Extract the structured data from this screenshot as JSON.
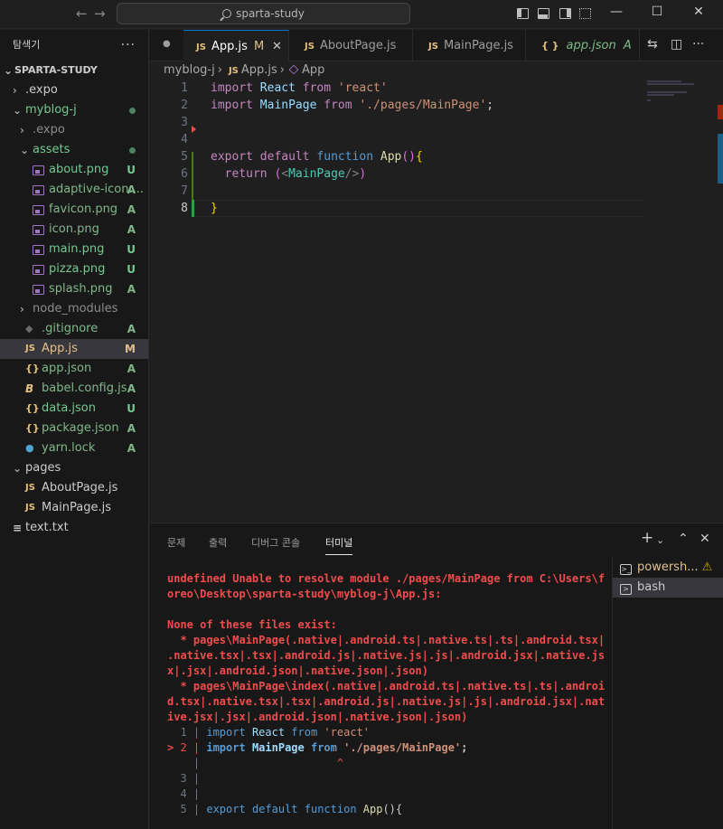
{
  "titlebar": {
    "search_text": "sparta-study",
    "back_icon": "arrow-left-icon",
    "forward_icon": "arrow-right-icon",
    "window_controls": [
      "minimize-icon",
      "maximize-icon",
      "close-icon"
    ]
  },
  "explorer": {
    "title": "탐색기",
    "more": "···",
    "root": "SPARTA-STUDY",
    "items": [
      {
        "label": ".expo",
        "type": "folder",
        "state": "collapsed",
        "status": ""
      },
      {
        "label": "myblog-j",
        "type": "folder",
        "state": "expanded",
        "status": "dot"
      },
      {
        "label": ".expo",
        "type": "folder",
        "state": "collapsed",
        "status": ""
      },
      {
        "label": "assets",
        "type": "folder",
        "state": "expanded",
        "status": "dot"
      },
      {
        "label": "about.png",
        "type": "image",
        "status": "U"
      },
      {
        "label": "adaptive-icon....",
        "type": "image",
        "status": "A"
      },
      {
        "label": "favicon.png",
        "type": "image",
        "status": "A"
      },
      {
        "label": "icon.png",
        "type": "image",
        "status": "A"
      },
      {
        "label": "main.png",
        "type": "image",
        "status": "U"
      },
      {
        "label": "pizza.png",
        "type": "image",
        "status": "U"
      },
      {
        "label": "splash.png",
        "type": "image",
        "status": "A"
      },
      {
        "label": "node_modules",
        "type": "folder",
        "state": "collapsed",
        "status": ""
      },
      {
        "label": ".gitignore",
        "type": "git",
        "status": "A"
      },
      {
        "label": "App.js",
        "type": "js",
        "status": "M"
      },
      {
        "label": "app.json",
        "type": "json",
        "status": "A"
      },
      {
        "label": "babel.config.js",
        "type": "babel",
        "status": "A"
      },
      {
        "label": "data.json",
        "type": "json",
        "status": "U"
      },
      {
        "label": "package.json",
        "type": "json",
        "status": "A"
      },
      {
        "label": "yarn.lock",
        "type": "yarn",
        "status": "A"
      },
      {
        "label": "pages",
        "type": "folder",
        "state": "expanded",
        "status": ""
      },
      {
        "label": "AboutPage.js",
        "type": "js",
        "status": ""
      },
      {
        "label": "MainPage.js",
        "type": "js",
        "status": ""
      },
      {
        "label": "text.txt",
        "type": "txt",
        "status": ""
      }
    ]
  },
  "tabs": [
    {
      "label": "App.js",
      "icon": "JS",
      "modified": "M",
      "active": true
    },
    {
      "label": "AboutPage.js",
      "icon": "JS",
      "active": false
    },
    {
      "label": "MainPage.js",
      "icon": "JS",
      "active": false
    },
    {
      "label": "app.json",
      "icon": "{ }",
      "status": "A",
      "active": false
    }
  ],
  "breadcrumb": {
    "folder": "myblog-j",
    "file": "App.js",
    "symbol": "App",
    "file_icon": "JS"
  },
  "editor": {
    "line_numbers": [
      "1",
      "2",
      "3",
      "4",
      "5",
      "6",
      "7",
      "8"
    ],
    "lines": [
      [
        {
          "t": "import",
          "c": "k1"
        },
        {
          "t": " React ",
          "c": "var"
        },
        {
          "t": "from",
          "c": "k1"
        },
        {
          "t": " 'react'",
          "c": "str"
        }
      ],
      [
        {
          "t": "import",
          "c": "k1"
        },
        {
          "t": " MainPage ",
          "c": "var"
        },
        {
          "t": "from",
          "c": "k1"
        },
        {
          "t": " './pages/MainPage'",
          "c": "str"
        },
        {
          "t": ";",
          "c": "tx"
        }
      ],
      [],
      [],
      [
        {
          "t": "export",
          "c": "k1"
        },
        {
          "t": " default ",
          "c": "k1"
        },
        {
          "t": "function",
          "c": "k2"
        },
        {
          "t": " App",
          "c": "fn"
        },
        {
          "t": "()",
          "c": "br2"
        },
        {
          "t": "{",
          "c": "br"
        }
      ],
      [
        {
          "t": "  return ",
          "c": "k1"
        },
        {
          "t": "(",
          "c": "br2"
        },
        {
          "t": "<",
          "c": "pn"
        },
        {
          "t": "MainPage",
          "c": "tag"
        },
        {
          "t": "/>",
          "c": "pn"
        },
        {
          "t": ")",
          "c": "br2"
        }
      ],
      [],
      [
        {
          "t": "}",
          "c": "br"
        }
      ]
    ]
  },
  "panel": {
    "tabs": [
      "문제",
      "출력",
      "디버그 콘솔",
      "터미널"
    ],
    "active_tab": "터미널",
    "actions": [
      "plus-icon",
      "chevron-down-icon",
      "chevron-up-icon",
      "close-icon"
    ],
    "terminal_lines": [
      {
        "text": "",
        "bold": false
      },
      {
        "text": "undefined Unable to resolve module ./pages/MainPage from C:\\Users\\f",
        "bold": true
      },
      {
        "text": "oreo\\Desktop\\sparta-study\\myblog-j\\App.js:",
        "bold": true
      },
      {
        "text": "",
        "bold": false
      },
      {
        "text": "None of these files exist:",
        "bold": true
      },
      {
        "text": "  * pages\\MainPage(.native|.android.ts|.native.ts|.ts|.android.tsx|",
        "bold": true
      },
      {
        "text": ".native.tsx|.tsx|.android.js|.native.js|.js|.android.jsx|.native.js",
        "bold": true
      },
      {
        "text": "x|.jsx|.android.json|.native.json|.json)",
        "bold": true
      },
      {
        "text": "  * pages\\MainPage\\index(.native|.android.ts|.native.ts|.ts|.androi",
        "bold": true
      },
      {
        "text": "d.tsx|.native.tsx|.tsx|.android.js|.native.js|.js|.android.jsx|.nat",
        "bold": true
      },
      {
        "text": "ive.jsx|.jsx|.android.json|.native.json|.json)",
        "bold": true
      }
    ],
    "code_frame": [
      {
        "marker": " ",
        "num": "1",
        "segs": [
          {
            "t": "import",
            "c": "k2"
          },
          {
            "t": " React ",
            "c": "var"
          },
          {
            "t": "from",
            "c": "k2"
          },
          {
            "t": " 'react'",
            "c": "str"
          }
        ]
      },
      {
        "marker": ">",
        "num": "2",
        "segs": [
          {
            "t": "import",
            "c": "k2"
          },
          {
            "t": " MainPage ",
            "c": "var"
          },
          {
            "t": "from",
            "c": "k2"
          },
          {
            "t": " './pages/MainPage'",
            "c": "str"
          },
          {
            "t": ";",
            "c": "tx"
          }
        ]
      },
      {
        "marker": " ",
        "num": "",
        "segs": [
          {
            "t": "                    ^",
            "c": "caret"
          }
        ]
      },
      {
        "marker": " ",
        "num": "3",
        "segs": []
      },
      {
        "marker": " ",
        "num": "4",
        "segs": []
      },
      {
        "marker": " ",
        "num": "5",
        "segs": [
          {
            "t": "export",
            "c": "k2"
          },
          {
            "t": " default ",
            "c": "k2"
          },
          {
            "t": "function",
            "c": "k2"
          },
          {
            "t": " App",
            "c": "fn"
          },
          {
            "t": "(){",
            "c": "tx"
          }
        ]
      }
    ],
    "terminals": [
      {
        "label": "powersh...",
        "warning": true,
        "selected": false
      },
      {
        "label": "bash",
        "warning": false,
        "selected": true
      }
    ]
  },
  "colors": {
    "accent": "#0078d4",
    "untracked": "#73c991",
    "added": "#81b88b",
    "modified": "#e2c08d",
    "error": "#f14c4c"
  }
}
